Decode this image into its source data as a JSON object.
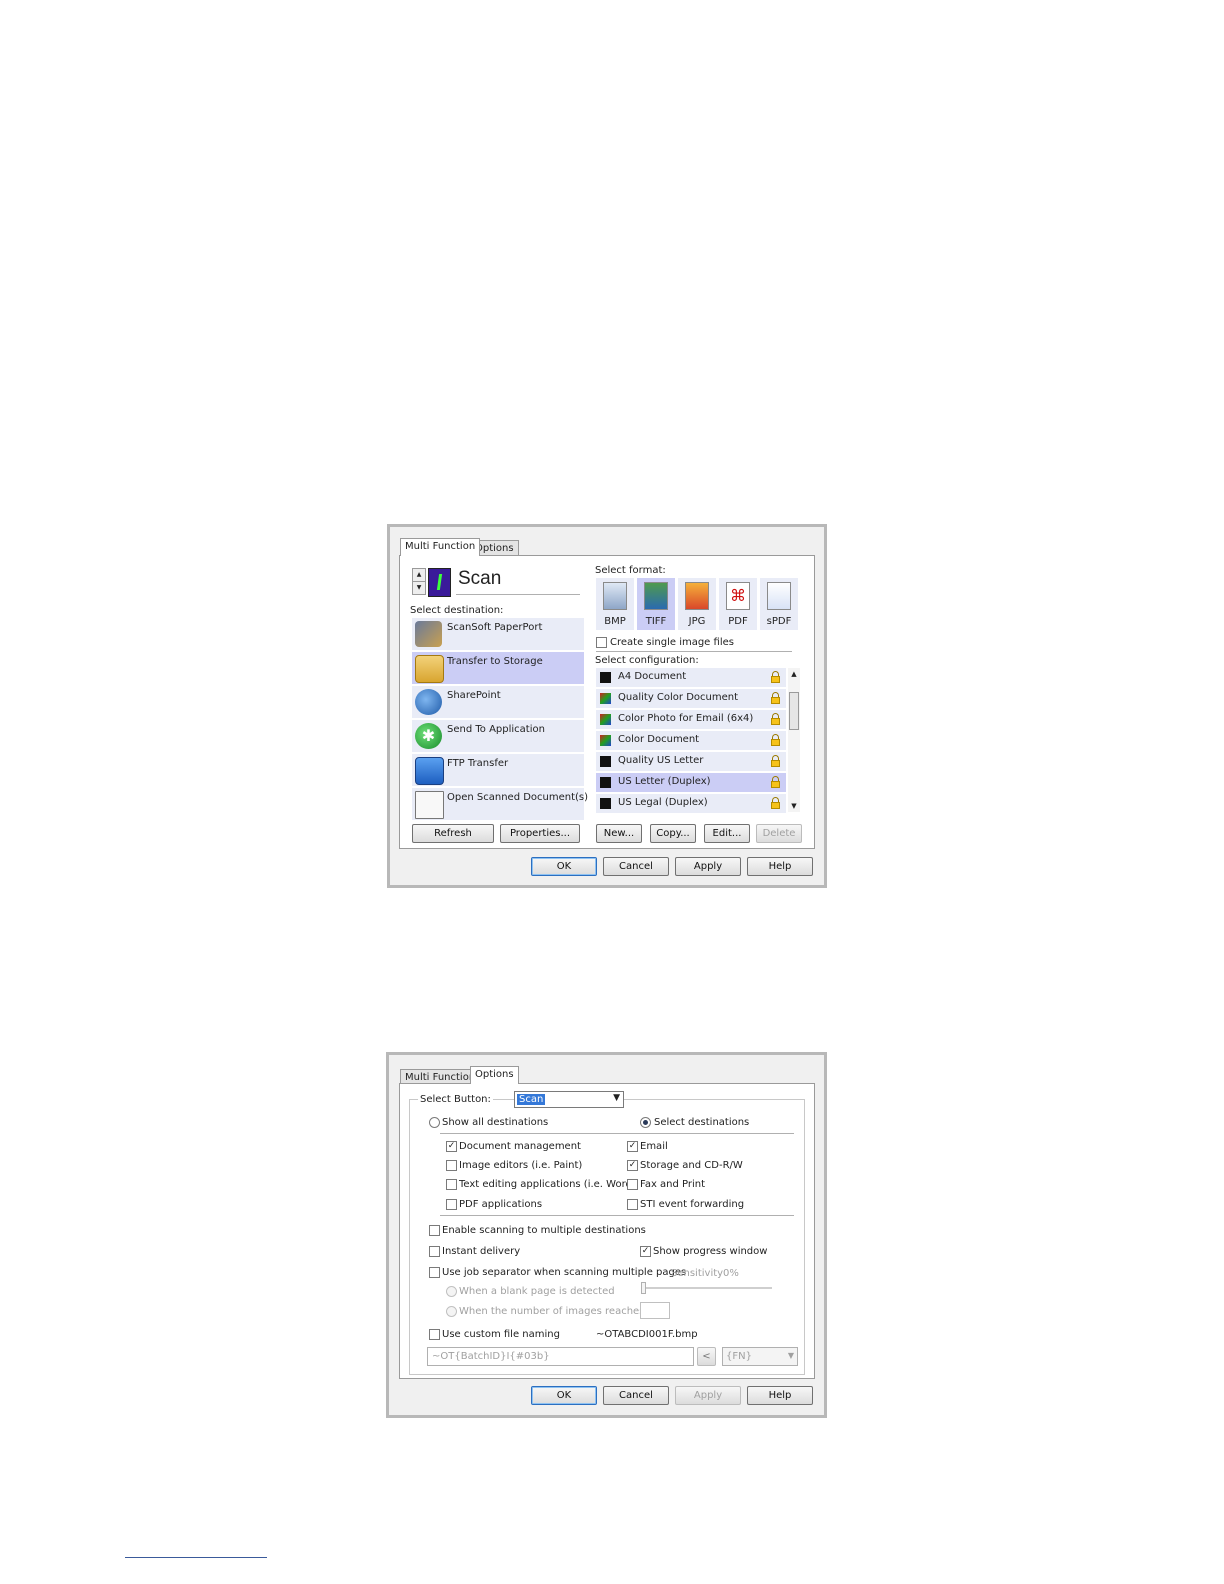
{
  "dialog1": {
    "tabs": [
      "Multi Function",
      "Options"
    ],
    "button_name": "Scan",
    "select_destination_label": "Select destination:",
    "destinations": [
      {
        "label": "ScanSoft PaperPort",
        "icon": "paperport-icon"
      },
      {
        "label": "Transfer to Storage",
        "icon": "storage-folder-icon"
      },
      {
        "label": "SharePoint",
        "icon": "sharepoint-icon"
      },
      {
        "label": "Send To Application",
        "icon": "send-to-app-icon"
      },
      {
        "label": "FTP Transfer",
        "icon": "ftp-icon"
      },
      {
        "label": "Open Scanned Document(s)",
        "icon": "open-document-icon"
      }
    ],
    "selected_destination": "Transfer to Storage",
    "select_format_label": "Select format:",
    "formats": [
      "BMP",
      "TIFF",
      "JPG",
      "PDF",
      "sPDF"
    ],
    "selected_format": "TIFF",
    "single_image_files_label": "Create single image files",
    "select_configuration_label": "Select configuration:",
    "configurations": [
      "A4 Document",
      "Quality Color Document",
      "Color Photo for Email (6x4)",
      "Color Document",
      "Quality US Letter",
      "US Letter (Duplex)",
      "US Legal (Duplex)"
    ],
    "selected_configuration": "US Letter (Duplex)",
    "buttons": {
      "refresh": "Refresh",
      "properties": "Properties...",
      "new": "New...",
      "copy": "Copy...",
      "edit": "Edit...",
      "delete": "Delete"
    },
    "footer": {
      "ok": "OK",
      "cancel": "Cancel",
      "apply": "Apply",
      "help": "Help"
    }
  },
  "dialog2": {
    "tabs": [
      "Multi Function",
      "Options"
    ],
    "select_button_label": "Select Button:",
    "select_button_value": "Scan",
    "show_all_destinations": "Show all destinations",
    "select_destinations": "Select destinations",
    "dest_types": {
      "document_management": "Document management",
      "image_editors": "Image editors (i.e. Paint)",
      "text_editing": "Text editing applications (i.e. Word)",
      "pdf_applications": "PDF applications",
      "email": "Email",
      "storage": "Storage and CD-R/W",
      "fax_print": "Fax and Print",
      "sti": "STI event forwarding"
    },
    "enable_multiple": "Enable scanning to multiple destinations",
    "instant_delivery": "Instant delivery",
    "show_progress": "Show progress window",
    "job_separator": "Use job separator when scanning multiple pages",
    "sensitivity_label": "Sensitivity",
    "sensitivity_value": "0%",
    "blank_page": "When a blank page is detected",
    "number_of_images": "When the number of images reaches",
    "custom_naming": "Use custom file naming",
    "filename_preview": "~OTABCDI001F.bmp",
    "naming_pattern": "~OT{BatchID}I{#03b}",
    "insert_button": "<",
    "token_value": "{FN}",
    "footer": {
      "ok": "OK",
      "cancel": "Cancel",
      "apply": "Apply",
      "help": "Help"
    }
  }
}
